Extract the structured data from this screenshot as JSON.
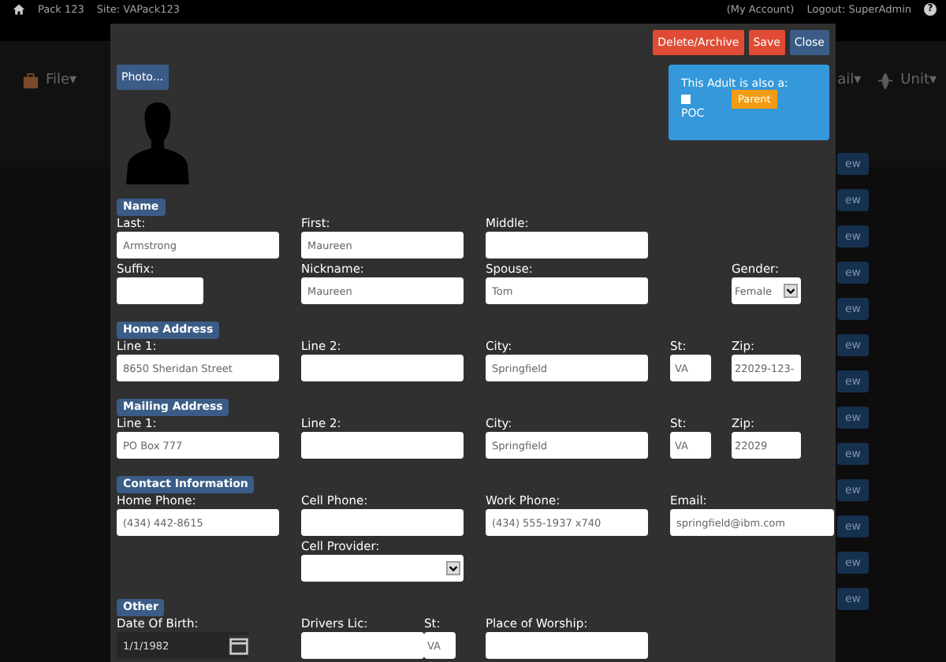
{
  "top_bar": {
    "home": "Pack 123",
    "site": "Site: VAPack123",
    "account": "(My Account)",
    "logout": "Logout: SuperAdmin",
    "help": "?"
  },
  "nav": [
    {
      "label": "File▾",
      "kind": "file"
    },
    {
      "label": "ail▾",
      "kind": "cut"
    },
    {
      "label": "Unit▾",
      "kind": "unit"
    }
  ],
  "background_buttons": [
    "ew",
    "ew",
    "ew",
    "ew",
    "ew",
    "ew",
    "ew",
    "ew",
    "ew",
    "ew",
    "ew",
    "ew",
    "ew"
  ],
  "modal": {
    "buttons": [
      {
        "label": "Delete/Archive",
        "kind": "danger"
      },
      {
        "label": "Save",
        "kind": "danger"
      },
      {
        "label": "Close",
        "kind": "primary"
      }
    ],
    "photo_button": "Photo...",
    "roles": {
      "title": "This Adult is also a:",
      "poc": {
        "label": "POC",
        "checked": false
      },
      "parent": "Parent"
    },
    "sections": [
      {
        "title": "Name",
        "rows": [
          [
            {
              "label": "Last:",
              "value": "Armstrong",
              "kind": "text"
            },
            {
              "label": "First:",
              "value": "Maureen",
              "kind": "text"
            },
            {
              "label": "Middle:",
              "kind": "text"
            }
          ],
          [
            {
              "label": "Suffix:",
              "kind": "text"
            },
            {
              "label": "Nickname:",
              "value": "Maureen",
              "kind": "text"
            },
            {
              "label": "Spouse:",
              "value": "Tom",
              "kind": "text"
            },
            {
              "kind": "empty"
            },
            {
              "label": "Gender:",
              "value": "Female",
              "kind": "select"
            }
          ]
        ]
      },
      {
        "title": "Home Address",
        "rows": [
          [
            {
              "label": "Line 1:",
              "value": "8650 Sheridan Street",
              "kind": "text"
            },
            {
              "label": "Line 2:",
              "kind": "text"
            },
            {
              "label": "City:",
              "value": "Springfield",
              "kind": "text"
            },
            {
              "label": "St:",
              "value": "VA",
              "kind": "text"
            },
            {
              "label": "Zip:",
              "value": "22029-123-",
              "kind": "text"
            }
          ]
        ]
      },
      {
        "title": "Mailing Address",
        "rows": [
          [
            {
              "label": "Line 1:",
              "value": "PO Box 777",
              "kind": "text"
            },
            {
              "label": "Line 2:",
              "kind": "text"
            },
            {
              "label": "City:",
              "value": "Springfield",
              "kind": "text"
            },
            {
              "label": "St:",
              "value": "VA",
              "kind": "text"
            },
            {
              "label": "Zip:",
              "value": "22029",
              "kind": "text"
            }
          ]
        ]
      },
      {
        "title": "Contact Information",
        "rows": [
          [
            {
              "label": "Home Phone:",
              "value": "(434) 442-8615",
              "kind": "text"
            },
            {
              "label": "Cell Phone:",
              "kind": "text"
            },
            {
              "label": "Work Phone:",
              "value": "(434) 555-1937 x740",
              "kind": "text"
            },
            {
              "label": "Email:",
              "value": "springfield@ibm.com",
              "kind": "text"
            }
          ],
          [
            {
              "kind": "empty"
            },
            {
              "label": "Cell Provider:",
              "kind": "select"
            }
          ]
        ]
      },
      {
        "title": "Other",
        "rows": [
          [
            {
              "label": "Date Of Birth:",
              "value": "1/1/1982",
              "kind": "date"
            },
            {
              "label": "Drivers Lic:",
              "kind": "text"
            },
            {
              "label": "St:",
              "value": "VA",
              "kind": "text"
            },
            {
              "label": "Place of Worship:",
              "kind": "text"
            }
          ]
        ]
      }
    ]
  }
}
